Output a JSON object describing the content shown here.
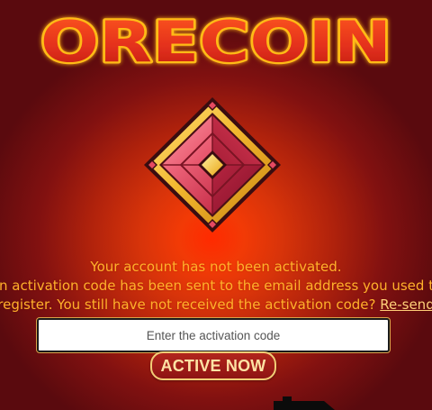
{
  "logo": {
    "text": "ORECOIN"
  },
  "gem": {
    "icon": "red-gem-icon"
  },
  "message": {
    "line1": "Your account has not been activated.",
    "line2": "An activation code has been sent to the email address you used to",
    "line3_prefix": "register. You still have not received the activation code?",
    "resend_link": "Re-send"
  },
  "activation": {
    "placeholder": "Enter the activation code",
    "value": ""
  },
  "button": {
    "label": "ACTIVE NOW"
  },
  "colors": {
    "message_text": "#ffb12b",
    "logo_fill": "#e83a1d",
    "logo_outline": "#ffbb14",
    "button_fill": "#9f1b16",
    "button_border": "#f2cd76"
  }
}
